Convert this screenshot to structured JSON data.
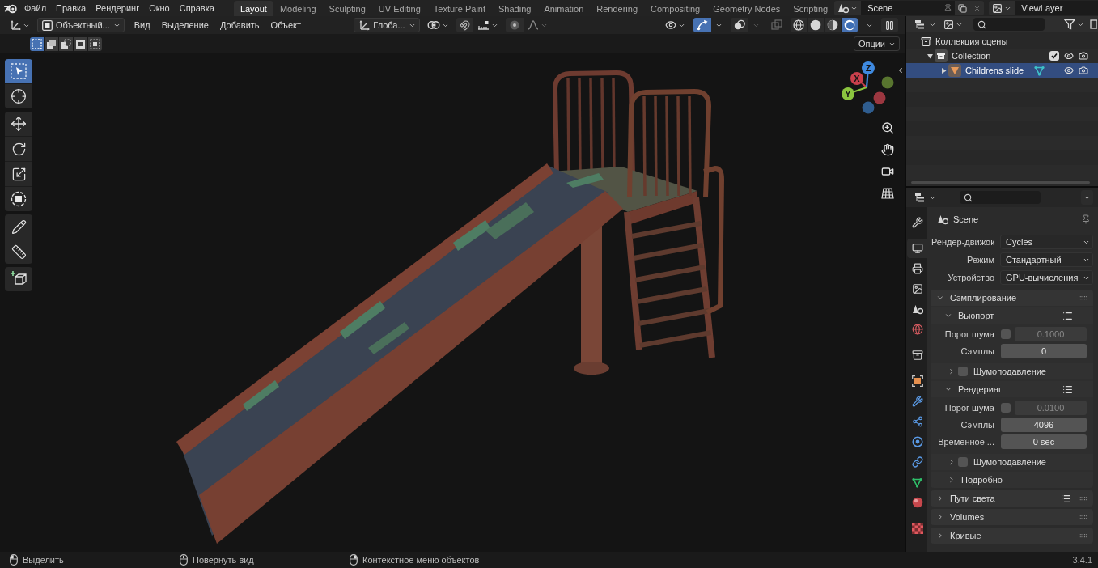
{
  "top_bar": {
    "menus": [
      "Файл",
      "Правка",
      "Рендеринг",
      "Окно",
      "Справка"
    ],
    "workspaces": [
      {
        "label": "Layout",
        "selected": true
      },
      {
        "label": "Modeling",
        "selected": false
      },
      {
        "label": "Sculpting",
        "selected": false
      },
      {
        "label": "UV Editing",
        "selected": false
      },
      {
        "label": "Texture Paint",
        "selected": false
      },
      {
        "label": "Shading",
        "selected": false
      },
      {
        "label": "Animation",
        "selected": false
      },
      {
        "label": "Rendering",
        "selected": false
      },
      {
        "label": "Compositing",
        "selected": false
      },
      {
        "label": "Geometry Nodes",
        "selected": false
      },
      {
        "label": "Scripting",
        "selected": false
      }
    ],
    "scene": "Scene",
    "view_layer": "ViewLayer"
  },
  "viewport": {
    "header": {
      "mode": "Объектный...",
      "menus": [
        "Вид",
        "Выделение",
        "Добавить",
        "Объект"
      ],
      "orientation": "Глоба...",
      "snapping": false,
      "proportional_editing": false,
      "gizmos": true,
      "overlays": false,
      "shading": [
        {
          "kind": "wireframe",
          "selected": false
        },
        {
          "kind": "solid",
          "selected": false
        },
        {
          "kind": "material",
          "selected": false
        },
        {
          "kind": "rendered",
          "selected": true
        }
      ]
    },
    "select_modes": [
      {
        "kind": "set",
        "selected": true
      },
      {
        "kind": "extend",
        "selected": false
      },
      {
        "kind": "subtract",
        "selected": false
      },
      {
        "kind": "invert",
        "selected": false
      },
      {
        "kind": "intersect",
        "selected": false
      }
    ],
    "options": "Опции",
    "tools": [
      [
        {
          "kind": "select_box",
          "selected": true
        },
        {
          "kind": "cursor",
          "selected": false
        }
      ],
      [
        {
          "kind": "move",
          "selected": false
        },
        {
          "kind": "rotate",
          "selected": false
        },
        {
          "kind": "scale",
          "selected": false
        },
        {
          "kind": "transform",
          "selected": false
        }
      ],
      [
        {
          "kind": "annotate",
          "selected": false
        },
        {
          "kind": "measure",
          "selected": false
        }
      ],
      [
        {
          "kind": "add_cube",
          "selected": false
        }
      ]
    ],
    "gizmo": {
      "axes": [
        {
          "label": "X",
          "color": "#c9404c"
        },
        {
          "label": "Y",
          "color": "#8bc53f"
        },
        {
          "label": "Z",
          "color": "#3f8ae0"
        }
      ],
      "negative_axes": [
        {
          "color": "#9c3740"
        },
        {
          "color": "#58752f"
        },
        {
          "color": "#2f5d8f"
        }
      ]
    }
  },
  "outliner": {
    "tree": [
      {
        "kind": "scene_collection",
        "label": "Коллекция сцены",
        "selected": false,
        "children": [
          {
            "kind": "collection",
            "label": "Collection",
            "expanded": true,
            "checked": true,
            "selected": false,
            "children": [
              {
                "kind": "object",
                "label": "Childrens slide",
                "expanded": false,
                "selected": true
              }
            ]
          }
        ]
      }
    ]
  },
  "properties": {
    "tabs": [
      [
        {
          "kind": "tool",
          "selected": false
        }
      ],
      [
        {
          "kind": "render",
          "selected": true
        },
        {
          "kind": "output",
          "selected": false
        },
        {
          "kind": "view_layer",
          "selected": false
        },
        {
          "kind": "scene",
          "selected": false
        },
        {
          "kind": "world",
          "selected": false
        }
      ],
      [
        {
          "kind": "collection",
          "selected": false
        }
      ],
      [
        {
          "kind": "object",
          "selected": false
        },
        {
          "kind": "modifiers",
          "selected": false
        },
        {
          "kind": "particles",
          "selected": false
        },
        {
          "kind": "physics",
          "selected": false
        },
        {
          "kind": "constraints",
          "selected": false
        },
        {
          "kind": "data",
          "selected": false
        },
        {
          "kind": "material",
          "selected": false
        }
      ],
      [
        {
          "kind": "texture",
          "selected": false
        }
      ]
    ],
    "context": "Scene",
    "fields": [
      {
        "label": "Рендер-движок",
        "value": "Cycles"
      },
      {
        "label": "Режим",
        "value": "Стандартный"
      },
      {
        "label": "Устройство",
        "value": "GPU-вычисления"
      }
    ],
    "panels": [
      {
        "title": "Сэмплирование",
        "expanded": true,
        "children": [
          {
            "title": "Вьюпорт",
            "expanded": true,
            "presets": true,
            "rows": [
              {
                "kind": "toggle_number",
                "label": "Порог шума",
                "checked": false,
                "value": "0.1000"
              },
              {
                "kind": "number",
                "label": "Сэмплы",
                "value": "0"
              }
            ],
            "children": [
              {
                "title": "Шумоподавление",
                "expanded": false,
                "checked": false
              }
            ]
          },
          {
            "title": "Рендеринг",
            "expanded": true,
            "presets": true,
            "rows": [
              {
                "kind": "toggle_number",
                "label": "Порог шума",
                "checked": false,
                "value": "0.0100"
              },
              {
                "kind": "number",
                "label": "Сэмплы",
                "value": "4096"
              },
              {
                "kind": "number",
                "label": "Временное ...",
                "value": "0 sec"
              }
            ],
            "children": [
              {
                "title": "Шумоподавление",
                "expanded": false,
                "checked": false
              },
              {
                "title": "Подробно",
                "expanded": false
              }
            ]
          }
        ]
      },
      {
        "title": "Пути света",
        "expanded": false,
        "presets": true
      },
      {
        "title": "Volumes",
        "expanded": false
      },
      {
        "title": "Кривые",
        "expanded": false
      }
    ]
  },
  "status_bar": {
    "hints": [
      {
        "kind": "left_click",
        "label": "Выделить"
      },
      {
        "kind": "middle_click",
        "label": "Повернуть вид"
      },
      {
        "kind": "right_click",
        "label": "Контекстное меню объектов"
      }
    ],
    "version": "3.4.1"
  }
}
